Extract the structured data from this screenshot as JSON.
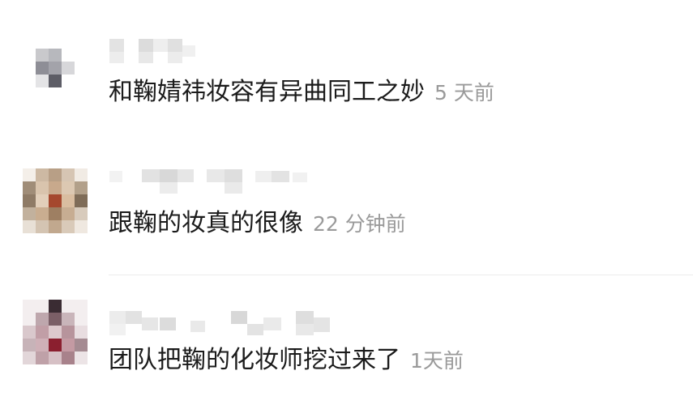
{
  "comments": [
    {
      "text": "和鞠婧祎妆容有异曲同工之妙",
      "time": "5 天前"
    },
    {
      "text": "跟鞠的妆真的很像",
      "time": "22 分钟前"
    },
    {
      "text": "团队把鞠的化妆师挖过来了",
      "time": "1天前"
    }
  ],
  "colors": {
    "text": "#1b1b1b",
    "timestamp": "#9a9a9a",
    "divider": "#ececec"
  }
}
